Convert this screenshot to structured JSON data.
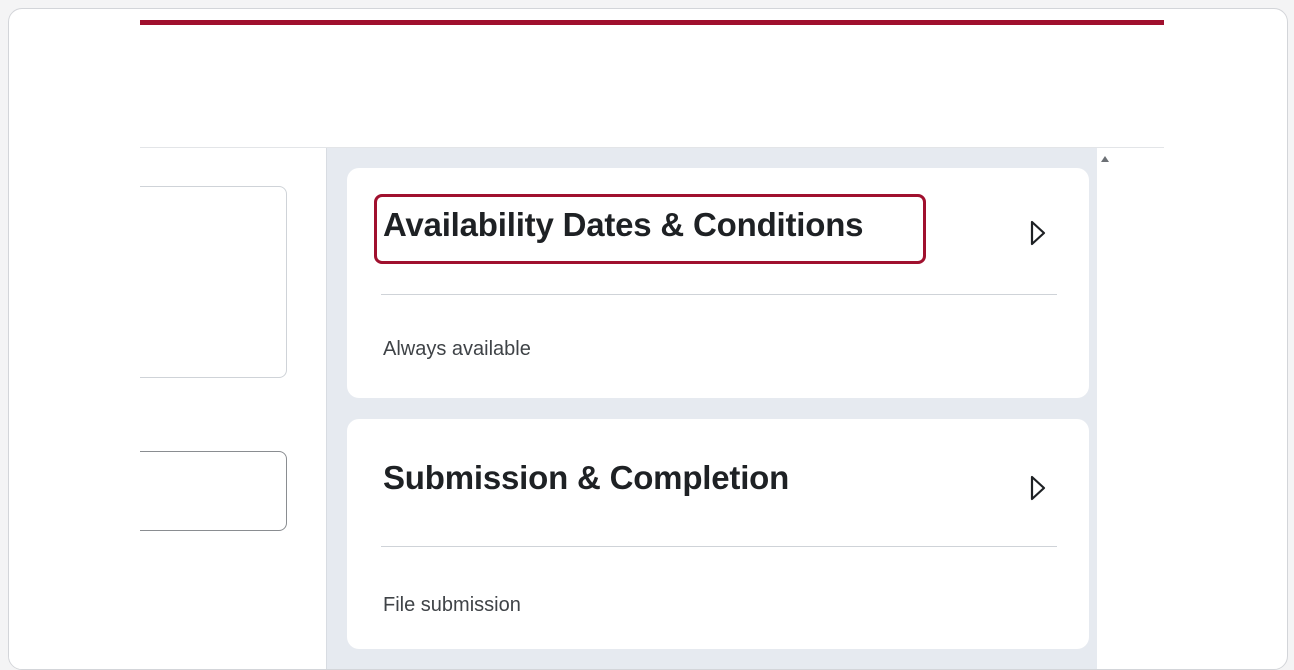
{
  "colors": {
    "accent": "#a0102e",
    "sidebar_bg": "#e6eaf0",
    "card_bg": "#ffffff"
  },
  "sidebar": {
    "cards": [
      {
        "title": "Availability Dates & Conditions",
        "subtitle": "Always available",
        "highlighted": true,
        "icon": "expand-triangle-icon"
      },
      {
        "title": "Submission & Completion",
        "subtitle": "File submission",
        "highlighted": false,
        "icon": "expand-triangle-icon"
      }
    ]
  }
}
